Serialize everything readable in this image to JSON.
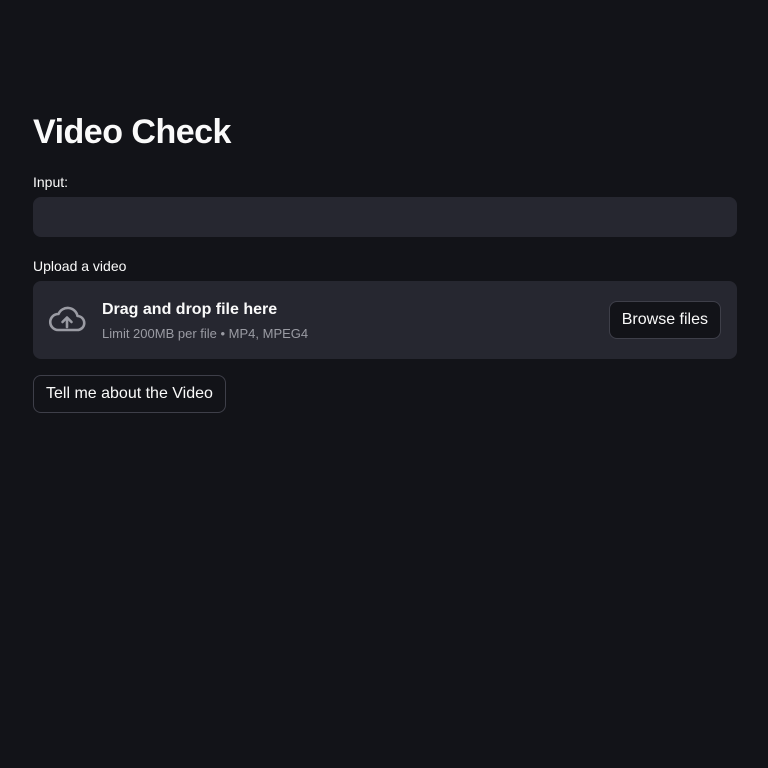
{
  "page": {
    "title": "Video Check"
  },
  "input": {
    "label": "Input:",
    "value": "",
    "placeholder": ""
  },
  "upload": {
    "label": "Upload a video",
    "dropzone_title": "Drag and drop file here",
    "dropzone_subtitle": "Limit 200MB per file • MP4, MPEG4",
    "browse_label": "Browse files",
    "icon": "cloud-upload-icon"
  },
  "action": {
    "button_label": "Tell me about the Video"
  },
  "colors": {
    "background": "#121318",
    "surface": "#262730",
    "text": "#fafafa",
    "muted_text": "#9a9ba3",
    "border": "#3e3f49"
  }
}
